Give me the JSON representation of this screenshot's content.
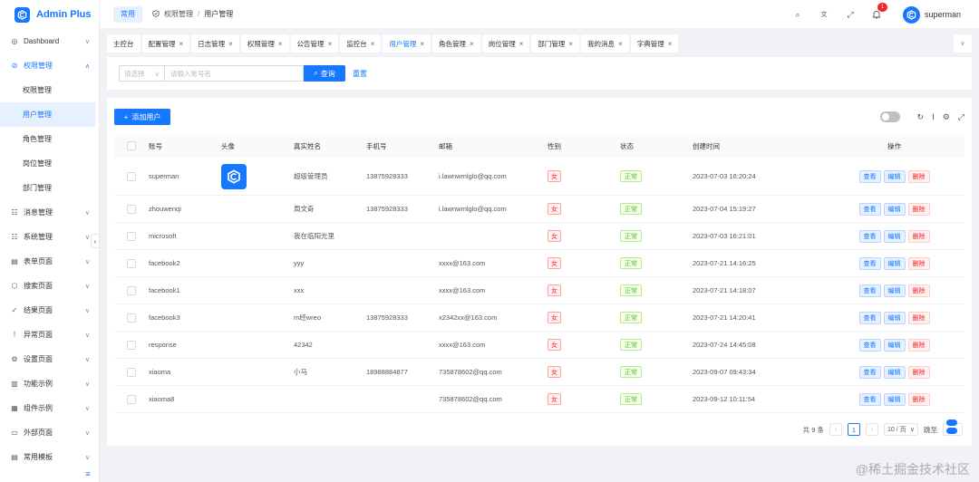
{
  "app": {
    "title": "Admin Plus"
  },
  "sidebar": {
    "items": [
      {
        "label": "Dashboard",
        "icon": "dashboard-icon",
        "glyph": "◎",
        "arrow": "∨"
      },
      {
        "label": "权限管理",
        "icon": "lock-icon",
        "glyph": "⊘",
        "arrow": "∧",
        "open": true,
        "children": [
          {
            "label": "权限管理"
          },
          {
            "label": "用户管理",
            "active": true
          },
          {
            "label": "角色管理"
          },
          {
            "label": "岗位管理"
          },
          {
            "label": "部门管理"
          }
        ]
      },
      {
        "label": "消息管理",
        "icon": "message-icon",
        "glyph": "☷",
        "arrow": "∨"
      },
      {
        "label": "系统管理",
        "icon": "system-icon",
        "glyph": "☷",
        "arrow": "∨"
      },
      {
        "label": "表单页面",
        "icon": "form-icon",
        "glyph": "▤",
        "arrow": "∨"
      },
      {
        "label": "搜索页面",
        "icon": "search-page-icon",
        "glyph": "⬡",
        "arrow": "∨"
      },
      {
        "label": "结果页面",
        "icon": "result-icon",
        "glyph": "✓",
        "arrow": "∨"
      },
      {
        "label": "异常页面",
        "icon": "error-icon",
        "glyph": "!",
        "arrow": "∨"
      },
      {
        "label": "设置页面",
        "icon": "settings-icon",
        "glyph": "⚙",
        "arrow": "∨"
      },
      {
        "label": "功能示例",
        "icon": "feature-icon",
        "glyph": "▥",
        "arrow": "∨"
      },
      {
        "label": "组件示例",
        "icon": "component-icon",
        "glyph": "▦",
        "arrow": "∨"
      },
      {
        "label": "外部页面",
        "icon": "monitor-icon",
        "glyph": "▭",
        "arrow": "∨"
      },
      {
        "label": "常用模板",
        "icon": "template-icon",
        "glyph": "▤",
        "arrow": "∨"
      }
    ],
    "collapse_glyph": "‹",
    "bottom_glyph": "≡"
  },
  "header": {
    "common_label": "常用",
    "breadcrumb": [
      "权限管理",
      "/",
      "用户管理"
    ],
    "username": "superman",
    "notification_count": "1",
    "icons": [
      {
        "name": "search-icon",
        "glyph": "⌕"
      },
      {
        "name": "translate-icon",
        "glyph": "文"
      },
      {
        "name": "fullscreen-icon",
        "glyph": "⤢"
      }
    ]
  },
  "tabs": [
    {
      "label": "主控台",
      "closable": false
    },
    {
      "label": "配置管理",
      "closable": true
    },
    {
      "label": "日志管理",
      "closable": true
    },
    {
      "label": "权限管理",
      "closable": true
    },
    {
      "label": "公告管理",
      "closable": true
    },
    {
      "label": "监控台",
      "closable": true
    },
    {
      "label": "用户管理",
      "closable": true,
      "active": true
    },
    {
      "label": "角色管理",
      "closable": true
    },
    {
      "label": "岗位管理",
      "closable": true
    },
    {
      "label": "部门管理",
      "closable": true
    },
    {
      "label": "我的消息",
      "closable": true
    },
    {
      "label": "字典管理",
      "closable": true
    }
  ],
  "search": {
    "select_placeholder": "请选择",
    "input_placeholder": "请输入账号名",
    "search_label": "查询",
    "reset_label": "重置"
  },
  "toolbar": {
    "add_label": "添加用户"
  },
  "table": {
    "columns": [
      "账号",
      "头像",
      "真实姓名",
      "手机号",
      "邮箱",
      "性别",
      "状态",
      "创建时间",
      "操作"
    ],
    "rows": [
      {
        "account": "superman",
        "avatar": true,
        "name": "超级管理员",
        "phone": "13875928333",
        "email": "i.lawnwmlglo@qq.com",
        "gender": "女",
        "status": "正常",
        "created": "2023-07-03 16:20:24"
      },
      {
        "account": "zhouwenqi",
        "avatar": false,
        "name": "周文奇",
        "phone": "13875928333",
        "email": "i.lawnwmlglo@qq.com",
        "gender": "女",
        "status": "正常",
        "created": "2023-07-04 15:19:27"
      },
      {
        "account": "microsoft",
        "avatar": false,
        "name": "我在临阳光里",
        "phone": "",
        "email": "",
        "gender": "女",
        "status": "正常",
        "created": "2023-07-03 16:21:01"
      },
      {
        "account": "facebook2",
        "avatar": false,
        "name": "yyy",
        "phone": "",
        "email": "xxxx@163.com",
        "gender": "女",
        "status": "正常",
        "created": "2023-07-21 14:16:25"
      },
      {
        "account": "facebook1",
        "avatar": false,
        "name": "xxx",
        "phone": "",
        "email": "xxxx@163.com",
        "gender": "女",
        "status": "正常",
        "created": "2023-07-21 14:18:07"
      },
      {
        "account": "facebook3",
        "avatar": false,
        "name": "m经wreo",
        "phone": "13875928333",
        "email": "x2342xx@163.com",
        "gender": "女",
        "status": "正常",
        "created": "2023-07-21 14:20:41"
      },
      {
        "account": "response",
        "avatar": false,
        "name": "42342",
        "phone": "",
        "email": "xxxx@163.com",
        "gender": "女",
        "status": "正常",
        "created": "2023-07-24 14:45:08"
      },
      {
        "account": "xiaoma",
        "avatar": false,
        "name": "小马",
        "phone": "18988884877",
        "email": "735878602@qq.com",
        "gender": "女",
        "status": "正常",
        "created": "2023-09-07 09:43:34"
      },
      {
        "account": "xiaoma8",
        "avatar": false,
        "name": "",
        "phone": "",
        "email": "735878602@qq.com",
        "gender": "女",
        "status": "正常",
        "created": "2023-09-12 10:11:54"
      }
    ],
    "ops": {
      "view": "查看",
      "edit": "编辑",
      "delete": "删除"
    }
  },
  "pagination": {
    "total": "共 9 条",
    "current_page": "1",
    "page_size": "10 / 页",
    "jump_label": "跳至"
  },
  "watermark": "@稀土掘金技术社区",
  "colors": {
    "primary": "#1677ff",
    "danger": "#f5222d",
    "success": "#52c41a"
  }
}
